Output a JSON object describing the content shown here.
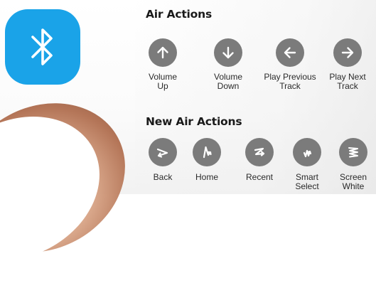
{
  "bluetooth": {
    "icon": "bluetooth-icon",
    "color": "#1aa3e8"
  },
  "air_actions": {
    "title": "Air Actions",
    "items": [
      {
        "icon": "arrow-up-icon",
        "line1": "Volume",
        "line2": "Up"
      },
      {
        "icon": "arrow-down-icon",
        "line1": "Volume",
        "line2": "Down"
      },
      {
        "icon": "arrow-left-icon",
        "line1": "Play Previous",
        "line2": "Track"
      },
      {
        "icon": "arrow-right-icon",
        "line1": "Play Next",
        "line2": "Track"
      }
    ]
  },
  "new_air_actions": {
    "title": "New Air Actions",
    "items": [
      {
        "icon": "back-gesture-icon",
        "line1": "Back",
        "line2": ""
      },
      {
        "icon": "home-gesture-icon",
        "line1": "Home",
        "line2": ""
      },
      {
        "icon": "recent-gesture-icon",
        "line1": "Recent",
        "line2": ""
      },
      {
        "icon": "smart-select-gesture-icon",
        "line1": "Smart",
        "line2": "Select"
      },
      {
        "icon": "screen-write-gesture-icon",
        "line1": "Screen",
        "line2": "White"
      }
    ]
  },
  "colors": {
    "icon_circle": "#7b7b7b",
    "text": "#2a2a2a"
  }
}
